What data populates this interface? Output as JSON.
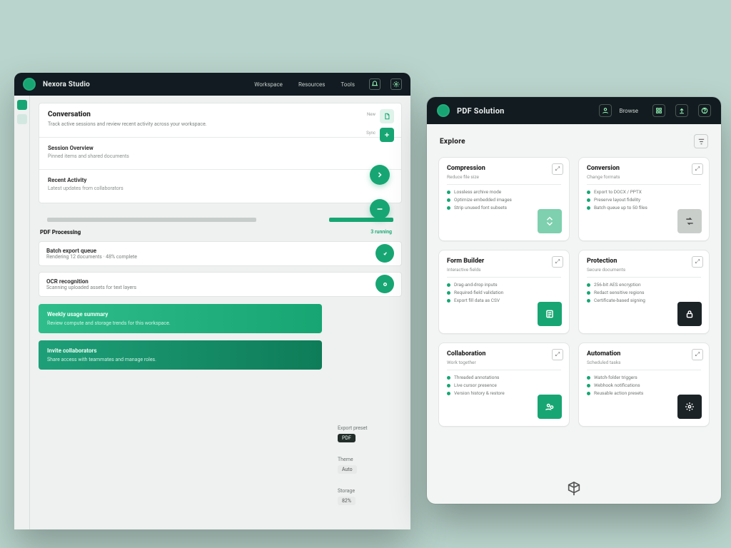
{
  "left": {
    "brand": "Nexora Studio",
    "menu": [
      "Workspace",
      "Resources",
      "Tools"
    ],
    "panel1": {
      "title": "Conversation",
      "desc": "Track active sessions and review recent activity across your workspace.",
      "sub1_title": "Session Overview",
      "sub1_desc": "Pinned items and shared documents",
      "sub2_title": "Recent Activity",
      "sub2_desc": "Latest updates from collaborators",
      "chip1": "New",
      "chip2": "Sync"
    },
    "section2": {
      "label": "PDF Processing",
      "tag": "3 running",
      "rows": [
        {
          "title": "Batch export queue",
          "desc": "Rendering 12 documents · 48% complete"
        },
        {
          "title": "OCR recognition",
          "desc": "Scanning uploaded assets for text layers"
        }
      ]
    },
    "tiles": [
      {
        "title": "Weekly usage summary",
        "desc": "Review compute and storage trends for this workspace."
      },
      {
        "title": "Invite collaborators",
        "desc": "Share access with teammates and manage roles."
      }
    ],
    "aside": [
      {
        "label": "Export preset",
        "chip": "PDF"
      },
      {
        "label": "Theme",
        "chip": "Auto"
      },
      {
        "label": "Storage",
        "chip": "82%"
      }
    ]
  },
  "right": {
    "brand": "PDF Solution",
    "toplink": "Browse",
    "section": "Explore",
    "cards": [
      {
        "title": "Compression",
        "meta": "Reduce file size",
        "items": [
          "Lossless archive mode",
          "Optimize embedded images",
          "Strip unused font subsets"
        ],
        "thumb": "lt"
      },
      {
        "title": "Conversion",
        "meta": "Change formats",
        "items": [
          "Export to DOCX / PPTX",
          "Preserve layout fidelity",
          "Batch queue up to 50 files"
        ],
        "thumb": "olv"
      },
      {
        "title": "Form Builder",
        "meta": "Interactive fields",
        "items": [
          "Drag-and-drop inputs",
          "Required-field validation",
          "Export fill data as CSV"
        ],
        "thumb": "grn"
      },
      {
        "title": "Protection",
        "meta": "Secure documents",
        "items": [
          "256-bit AES encryption",
          "Redact sensitive regions",
          "Certificate-based signing"
        ],
        "thumb": "dk"
      },
      {
        "title": "Collaboration",
        "meta": "Work together",
        "items": [
          "Threaded annotations",
          "Live cursor presence",
          "Version history & restore"
        ],
        "thumb": "grn"
      },
      {
        "title": "Automation",
        "meta": "Scheduled tasks",
        "items": [
          "Watch-folder triggers",
          "Webhook notifications",
          "Reusable action presets"
        ],
        "thumb": "dk"
      }
    ]
  }
}
